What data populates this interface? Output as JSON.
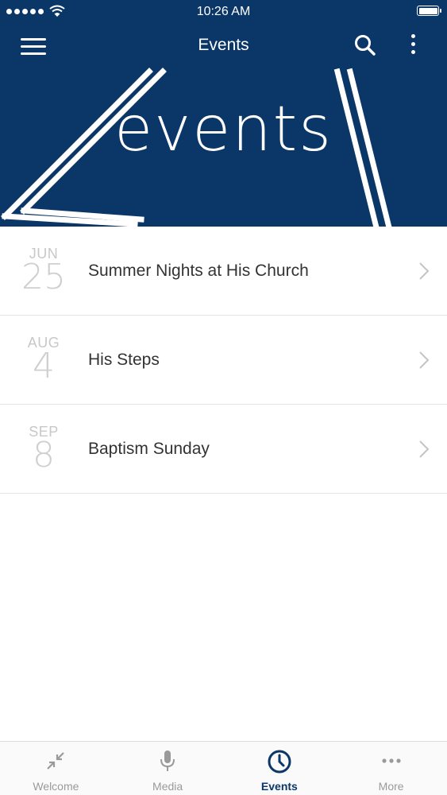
{
  "status_bar": {
    "time": "10:26 AM"
  },
  "nav": {
    "title": "Events"
  },
  "banner": {
    "text": "events"
  },
  "events": [
    {
      "month": "JUN",
      "day": "25",
      "title": "Summer Nights at His Church"
    },
    {
      "month": "AUG",
      "day": "4",
      "title": "His Steps"
    },
    {
      "month": "SEP",
      "day": "8",
      "title": "Baptism Sunday"
    }
  ],
  "tabs": [
    {
      "label": "Welcome",
      "icon": "collapse-arrows-icon",
      "active": false
    },
    {
      "label": "Media",
      "icon": "microphone-icon",
      "active": false
    },
    {
      "label": "Events",
      "icon": "clock-icon",
      "active": true
    },
    {
      "label": "More",
      "icon": "more-dots-icon",
      "active": false
    }
  ],
  "colors": {
    "header_bg": "#0b3768",
    "active_tab": "#0b3768",
    "inactive_tab": "#9a9a9a"
  }
}
